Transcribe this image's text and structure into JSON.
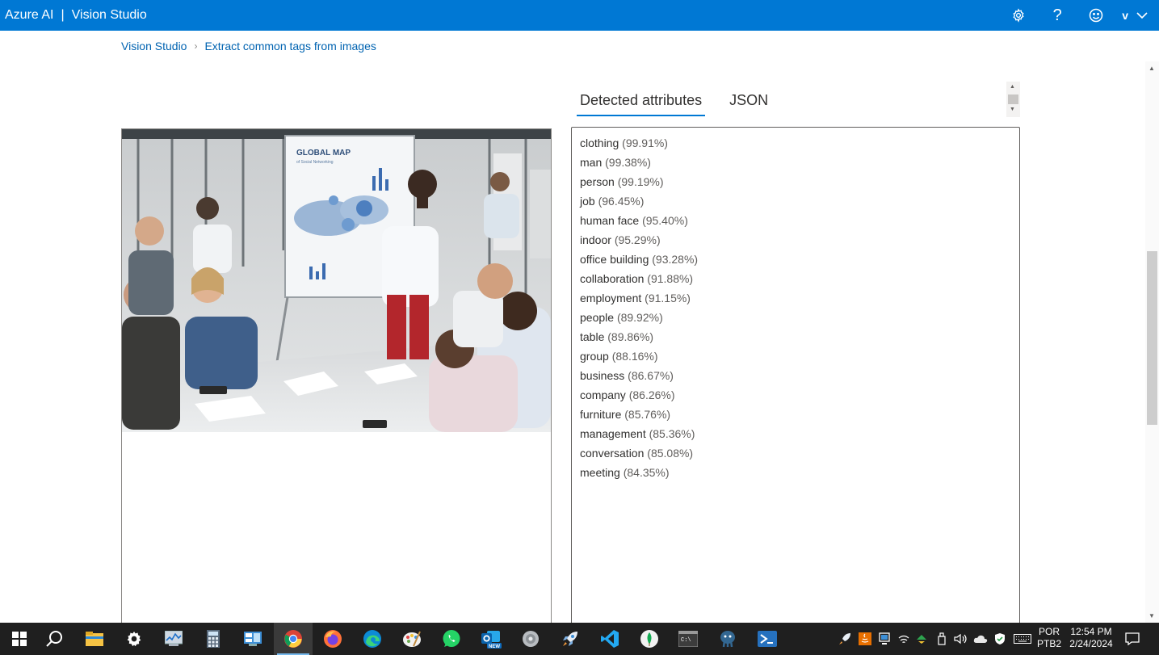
{
  "header": {
    "brand": "Azure AI",
    "separator": "|",
    "product": "Vision Studio",
    "settings_icon": "gear-icon",
    "help_label": "?",
    "feedback_icon": "smiley-icon",
    "user_initial": "v",
    "colors": {
      "bar": "#0078d4",
      "text": "#ffffff"
    }
  },
  "breadcrumb": {
    "root": "Vision Studio",
    "separator": "›",
    "current": "Extract common tags from images"
  },
  "tabs": [
    {
      "label": "Detected attributes",
      "active": true
    },
    {
      "label": "JSON",
      "active": false
    }
  ],
  "image": {
    "map_title": "GLOBAL MAP",
    "map_subtitle": "of Social Networking"
  },
  "attributes": [
    {
      "name": "clothing",
      "confidence": "(99.91%)"
    },
    {
      "name": "man",
      "confidence": "(99.38%)"
    },
    {
      "name": "person",
      "confidence": "(99.19%)"
    },
    {
      "name": "job",
      "confidence": "(96.45%)"
    },
    {
      "name": "human face",
      "confidence": "(95.40%)"
    },
    {
      "name": "indoor",
      "confidence": "(95.29%)"
    },
    {
      "name": "office building",
      "confidence": "(93.28%)"
    },
    {
      "name": "collaboration",
      "confidence": "(91.88%)"
    },
    {
      "name": "employment",
      "confidence": "(91.15%)"
    },
    {
      "name": "people",
      "confidence": "(89.92%)"
    },
    {
      "name": "table",
      "confidence": "(89.86%)"
    },
    {
      "name": "group",
      "confidence": "(88.16%)"
    },
    {
      "name": "business",
      "confidence": "(86.67%)"
    },
    {
      "name": "company",
      "confidence": "(86.26%)"
    },
    {
      "name": "furniture",
      "confidence": "(85.76%)"
    },
    {
      "name": "management",
      "confidence": "(85.36%)"
    },
    {
      "name": "conversation",
      "confidence": "(85.08%)"
    },
    {
      "name": "meeting",
      "confidence": "(84.35%)"
    }
  ],
  "taskbar": {
    "apps": [
      "start-icon",
      "search-icon",
      "file-explorer-icon",
      "settings-icon",
      "task-manager-icon",
      "calculator-icon",
      "control-panel-icon",
      "chrome-icon",
      "firefox-icon",
      "edge-icon",
      "paint-icon",
      "whatsapp-icon",
      "outlook-new-icon",
      "disc-icon",
      "rocket-icon",
      "vscode-icon",
      "mongodb-icon",
      "terminal-icon",
      "postgres-icon",
      "powershell-icon"
    ],
    "active_app": "chrome-icon",
    "language": "POR",
    "keyboard": "PTB2",
    "time": "12:54 PM",
    "date": "2/24/2024"
  }
}
